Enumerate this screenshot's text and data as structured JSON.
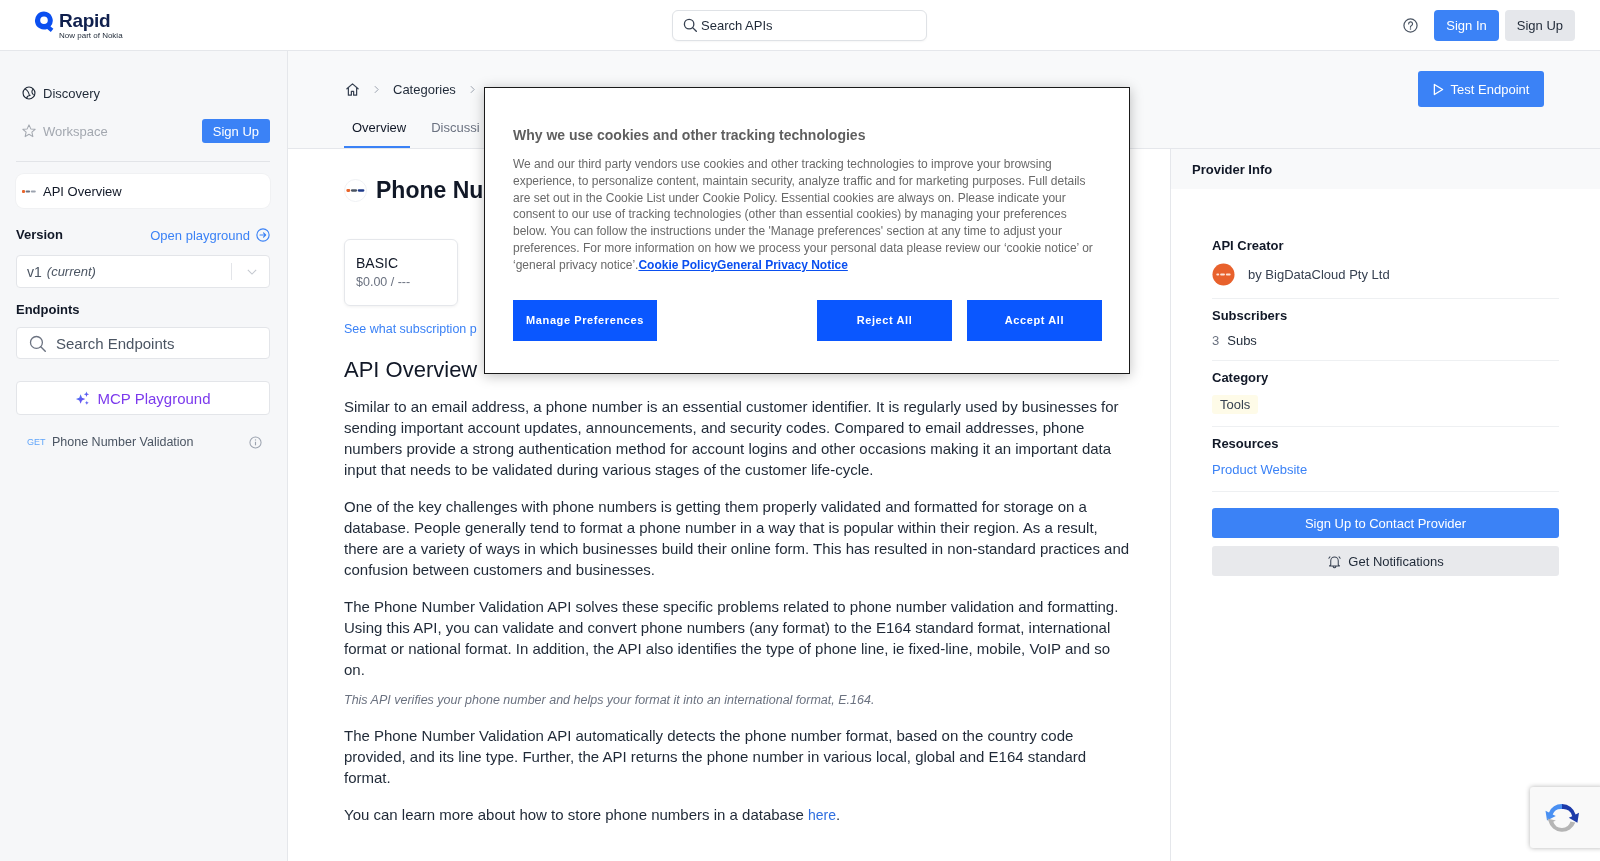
{
  "header": {
    "logo": {
      "name": "Rapid",
      "tagline": "Now part of Nokia"
    },
    "search": {
      "placeholder": "Search APIs"
    },
    "buttons": [
      {
        "label": "Sign In",
        "kind": "primary"
      },
      {
        "label": "Sign Up",
        "kind": "secondary"
      }
    ]
  },
  "sidebar": {
    "nav": [
      {
        "label": "Discovery",
        "disabled": false
      },
      {
        "label": "Workspace",
        "disabled": true,
        "action": "Sign Up"
      }
    ],
    "overview_item": {
      "label": "API Overview",
      "selected": true
    },
    "version": {
      "label": "Version",
      "link": "Open playground",
      "value": "v1",
      "note": "(current)"
    },
    "endpoints": {
      "label": "Endpoints",
      "search_placeholder": "Search Endpoints",
      "mcp_button": "MCP Playground",
      "items": [
        {
          "method": "GET",
          "name": "Phone Number Validation"
        }
      ]
    }
  },
  "main": {
    "breadcrumb": [
      "Categories"
    ],
    "test_button": "Test Endpoint",
    "tabs": [
      {
        "label": "Overview",
        "selected": true
      },
      {
        "label": "Discussi",
        "selected": false
      }
    ],
    "title": "Phone Nu",
    "plans": [
      {
        "name": "BASIC",
        "price": "$0.00 / ---"
      }
    ],
    "plans_link": "See what subscription p",
    "overview": {
      "heading": "API Overview",
      "blocks": [
        {
          "kind": "paragraph",
          "text": "Similar to an email address, a phone number is an essential customer identifier. It is regularly used by businesses for sending important account updates, announcements, and security codes. Compared to email addresses, phone numbers provide a strong authentication method for account logins and other occasions making it an important data input that needs to be validated during various stages of the customer life-cycle."
        },
        {
          "kind": "paragraph",
          "text": "One of the key challenges with phone numbers is getting them properly validated and formatted for storage on a database. People generally tend to format a phone number in a way that is popular within their region. As a result, there are a variety of ways in which businesses build their online form. This has resulted in non-standard practices and confusion between customers and businesses."
        },
        {
          "kind": "paragraph",
          "text": "The Phone Number Validation API solves these specific problems related to phone number validation and formatting. Using this API, you can validate and convert phone numbers (any format) to the E164 standard format, international format or national format. In addition, the API also identifies the type of phone line, ie fixed-line, mobile, VoIP and so on."
        },
        {
          "kind": "note",
          "text": "This API verifies your phone number and helps your format it into an international format, E.164."
        },
        {
          "kind": "paragraph",
          "text": "The Phone Number Validation API automatically detects the phone number format, based on the country code provided, and its line type. Further, the API returns the phone number in various local, global and E164 standard format."
        },
        {
          "kind": "link_paragraph",
          "text": "You can learn more about how to store phone numbers in a database",
          "link": "here",
          "after": "."
        }
      ]
    }
  },
  "provider_panel": {
    "title": "Provider Info",
    "sections": [
      {
        "kind": "creator",
        "label": "API Creator",
        "value": "by BigDataCloud Pty Ltd"
      },
      {
        "kind": "count",
        "label": "Subscribers",
        "count": "3",
        "unit": "Subs"
      },
      {
        "kind": "tag",
        "label": "Category",
        "value": "Tools"
      },
      {
        "kind": "link",
        "label": "Resources",
        "value": "Product Website"
      }
    ],
    "buttons": [
      {
        "label": "Sign Up to Contact Provider",
        "kind": "primary"
      },
      {
        "label": "Get Notifications",
        "kind": "notify"
      }
    ]
  },
  "cookie_dialog": {
    "title": "Why we use cookies and other tracking technologies",
    "body": "We and our third party vendors use cookies and other tracking technologies to improve your browsing experience, to personalize content, maintain security, analyze traffic and for marketing purposes. Full details are set out in the Cookie List under Cookie Policy. Essential cookies are always on. Please indicate your consent to our use of tracking technologies (other than essential cookies) by managing your preferences below. You can follow the instructions under the 'Manage preferences' section at any time to adjust your preferences. For more information on how we process your personal data please review our ‘cookie notice’ or ‘general privacy notice’.",
    "links": [
      "Cookie Policy",
      "General Privacy Notice"
    ],
    "buttons": [
      {
        "label": "Manage Preferences",
        "kind": "preferences"
      },
      {
        "label": "Reject All",
        "kind": "reject"
      },
      {
        "label": "Accept All",
        "kind": "accept"
      }
    ]
  }
}
